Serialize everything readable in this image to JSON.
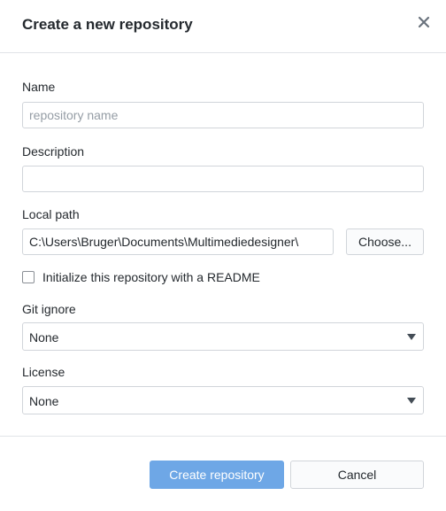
{
  "dialog": {
    "title": "Create a new repository",
    "close_icon": "close-icon"
  },
  "form": {
    "name": {
      "label": "Name",
      "placeholder": "repository name",
      "value": ""
    },
    "description": {
      "label": "Description",
      "value": ""
    },
    "local_path": {
      "label": "Local path",
      "value": "C:\\Users\\Bruger\\Documents\\Multimediedesigner\\",
      "choose_label": "Choose..."
    },
    "readme": {
      "label": "Initialize this repository with a README",
      "checked": false
    },
    "git_ignore": {
      "label": "Git ignore",
      "selected": "None"
    },
    "license": {
      "label": "License",
      "selected": "None"
    }
  },
  "footer": {
    "create_label": "Create repository",
    "cancel_label": "Cancel"
  },
  "colors": {
    "primary_button": "#6ea7e6",
    "text": "#24292e",
    "border": "#d1d5da"
  }
}
